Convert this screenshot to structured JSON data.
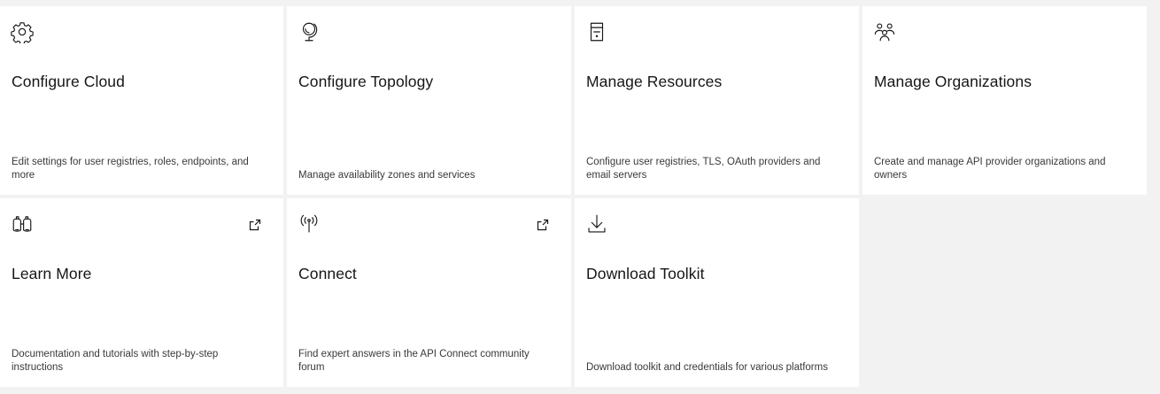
{
  "tiles": [
    {
      "title": "Configure Cloud",
      "description": "Edit settings for user registries, roles, endpoints, and more",
      "icon": "gear-icon"
    },
    {
      "title": "Configure Topology",
      "description": "Manage availability zones and services",
      "icon": "globe-icon"
    },
    {
      "title": "Manage Resources",
      "description": "Configure user registries, TLS, OAuth providers and email servers",
      "icon": "server-icon"
    },
    {
      "title": "Manage Organizations",
      "description": "Create and manage API provider organizations and owners",
      "icon": "group-icon"
    },
    {
      "title": "Learn More",
      "description": "Documentation and tutorials with step-by-step instructions",
      "icon": "binoculars-icon",
      "external": true
    },
    {
      "title": "Connect",
      "description": "Find expert answers in the API Connect community forum",
      "icon": "antenna-icon",
      "external": true
    },
    {
      "title": "Download Toolkit",
      "description": "Download toolkit and credentials for various platforms",
      "icon": "download-icon"
    }
  ]
}
